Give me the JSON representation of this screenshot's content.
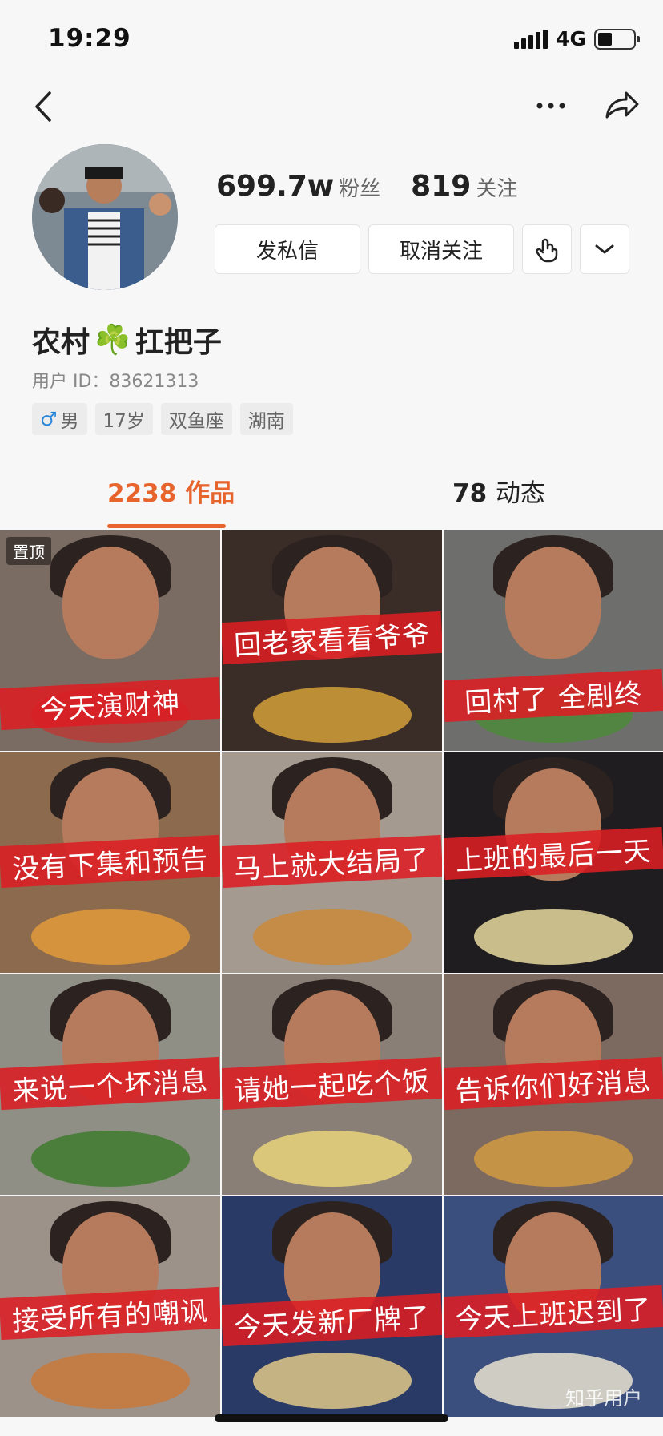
{
  "status": {
    "time": "19:29",
    "network": "4G"
  },
  "profile": {
    "fans_count": "699.7w",
    "fans_label": "粉丝",
    "following_count": "819",
    "following_label": "关注",
    "name_part1": "农村",
    "name_emoji": "☘️",
    "name_part2": "扛把子",
    "user_id": "用户 ID：83621313",
    "tags": {
      "gender_symbol": "♂",
      "gender": "男",
      "age": "17岁",
      "zodiac": "双鱼座",
      "region": "湖南"
    }
  },
  "actions": {
    "message": "发私信",
    "unfollow": "取消关注"
  },
  "tabs": {
    "works_count": "2238",
    "works_label": "作品",
    "posts_count": "78",
    "posts_label": "动态"
  },
  "grid": {
    "pinned_label": "置顶",
    "captions": [
      "今天演财神",
      "回老家看看爷爷",
      "回村了 全剧终",
      "没有下集和预告",
      "马上就大结局了",
      "上班的最后一天",
      "来说一个坏消息",
      "请她一起吃个饭",
      "告诉你们好消息",
      "接受所有的嘲讽",
      "今天发新厂牌了",
      "今天上班迟到了"
    ]
  },
  "watermark": "知乎用户",
  "colors": {
    "accent": "#e8642d",
    "caption_bg": "#dc1e23"
  },
  "icons": [
    "back-icon",
    "more-icon",
    "share-icon",
    "gesture-icon",
    "chevron-down-icon",
    "male-icon"
  ]
}
